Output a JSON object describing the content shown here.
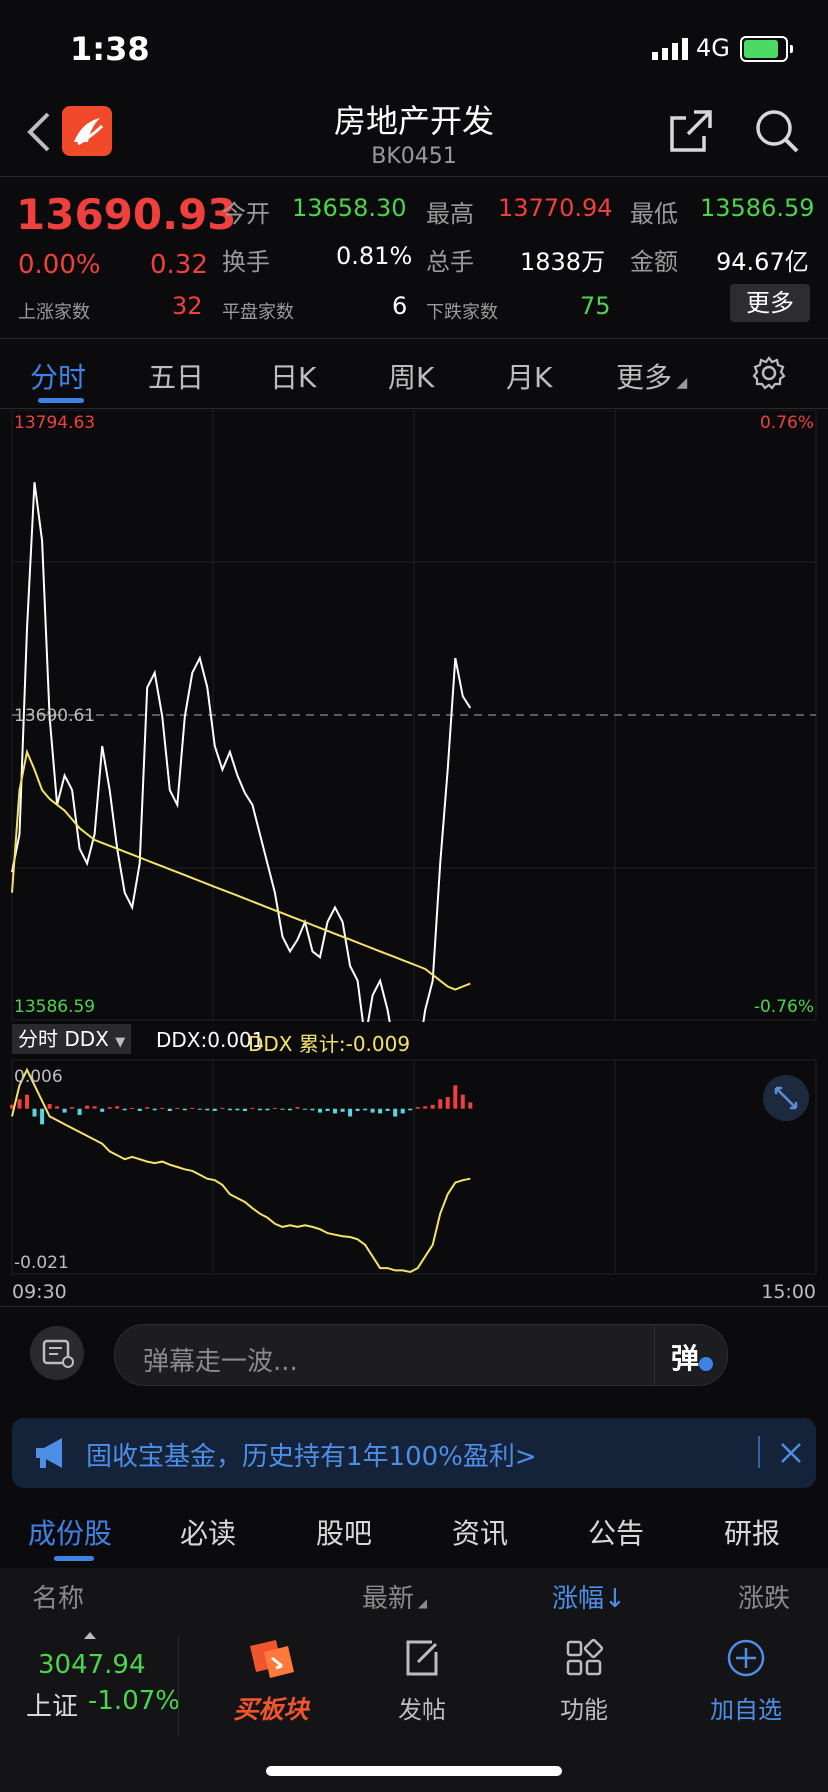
{
  "status_bar": {
    "time": "1:38",
    "network": "4G"
  },
  "nav": {
    "title": "房地产开发",
    "code": "BK0451"
  },
  "quote": {
    "price": "13690.93",
    "change_pct": "0.00%",
    "change": "0.32",
    "open_label": "今开",
    "open": "13658.30",
    "high_label": "最高",
    "high": "13770.94",
    "low_label": "最低",
    "low": "13586.59",
    "turnover_label": "换手",
    "turnover": "0.81%",
    "volume_label": "总手",
    "volume": "1838万",
    "amount_label": "金额",
    "amount": "94.67亿",
    "up_label": "上涨家数",
    "up": "32",
    "flat_label": "平盘家数",
    "flat": "6",
    "down_label": "下跌家数",
    "down": "75",
    "more_button": "更多"
  },
  "chart_tabs": [
    "分时",
    "五日",
    "日K",
    "周K",
    "月K",
    "更多"
  ],
  "chart_data": [
    {
      "type": "line",
      "y_top_label": "13794.63",
      "y_mid_label": "13690.61",
      "y_bottom_label": "13586.59",
      "pct_top_label": "0.76%",
      "pct_bottom_label": "-0.76%",
      "ylim": [
        13586.59,
        13794.63
      ],
      "baseline": 13690.61,
      "grid": true,
      "series": [
        {
          "values": [
            13637,
            13650,
            13720,
            13770,
            13750,
            13690,
            13660,
            13670,
            13665,
            13645,
            13640,
            13650,
            13680,
            13665,
            13645,
            13630,
            13625,
            13640,
            13700,
            13705,
            13690,
            13665,
            13660,
            13690,
            13705,
            13710,
            13700,
            13680,
            13672,
            13678,
            13670,
            13664,
            13660,
            13650,
            13640,
            13630,
            13615,
            13610,
            13614,
            13620,
            13610,
            13608,
            13620,
            13625,
            13620,
            13605,
            13600,
            13580,
            13595,
            13600,
            13590,
            13575,
            13570,
            13578,
            13573,
            13590,
            13600,
            13640,
            13672,
            13710,
            13697,
            13693
          ]
        },
        {
          "values": [
            13630,
            13665,
            13678,
            13672,
            13665,
            13662,
            13660,
            13658,
            13655,
            13652,
            13650,
            13648,
            13647,
            13646,
            13645,
            13644,
            13643,
            13642,
            13641,
            13640,
            13639,
            13638,
            13637,
            13636,
            13635,
            13634,
            13633,
            13632,
            13631,
            13630,
            13629,
            13628,
            13627,
            13626,
            13625,
            13624,
            13623,
            13622,
            13621,
            13620,
            13619,
            13618,
            13617,
            13616,
            13615,
            13614,
            13613,
            13612,
            13611,
            13610,
            13609,
            13608,
            13607,
            13606,
            13605,
            13604,
            13602,
            13600,
            13598,
            13597,
            13598,
            13599
          ]
        }
      ]
    },
    {
      "type": "bar",
      "ylim": [
        -0.021,
        0.006
      ],
      "legend_name": "分时 DDX",
      "ddx_label": "DDX:0.001",
      "ddx_cum_label": "DDX 累计:-0.009",
      "y_top_label": "0.006",
      "y_bottom_label": "-0.021",
      "x_start_label": "09:30",
      "x_end_label": "15:00",
      "series": [
        {
          "values": [
            0.0005,
            0.0012,
            0.0018,
            -0.001,
            -0.002,
            0.0006,
            0.0003,
            -0.0005,
            0.0002,
            -0.0008,
            0.0004,
            0.0003,
            -0.0004,
            0.0002,
            0.0003,
            -0.0002,
            0.0001,
            -0.0003,
            0.0002,
            -0.0002,
            0.0001,
            -0.0003,
            0.0001,
            -0.0002,
            0.0001,
            -0.0001,
            -0.0002,
            -0.0003,
            0.0001,
            -0.0002,
            -0.0002,
            -0.0003,
            0.0001,
            -0.0002,
            -0.0002,
            0.0001,
            -0.0001,
            -0.0002,
            0.0002,
            -0.0001,
            -0.0002,
            -0.0005,
            -0.0003,
            -0.0006,
            -0.0004,
            -0.001,
            -0.0003,
            -0.0002,
            -0.0005,
            -0.0006,
            -0.0003,
            -0.001,
            -0.0006,
            -0.0002,
            0.0002,
            0.0003,
            0.0005,
            0.0012,
            0.0015,
            0.003,
            0.0018,
            0.0008
          ]
        },
        {
          "values": [
            -0.001,
            0.003,
            0.005,
            0.003,
            0.001,
            -0.001,
            -0.0015,
            -0.002,
            -0.0025,
            -0.003,
            -0.0035,
            -0.004,
            -0.0045,
            -0.0055,
            -0.006,
            -0.0065,
            -0.0062,
            -0.0065,
            -0.0068,
            -0.007,
            -0.0068,
            -0.0072,
            -0.0075,
            -0.0078,
            -0.008,
            -0.0085,
            -0.009,
            -0.0092,
            -0.0098,
            -0.011,
            -0.0115,
            -0.012,
            -0.0128,
            -0.0135,
            -0.014,
            -0.0148,
            -0.0152,
            -0.015,
            -0.0152,
            -0.015,
            -0.0152,
            -0.0155,
            -0.016,
            -0.0162,
            -0.0164,
            -0.0165,
            -0.0168,
            -0.0175,
            -0.019,
            -0.0205,
            -0.0205,
            -0.0208,
            -0.0208,
            -0.021,
            -0.0205,
            -0.019,
            -0.0175,
            -0.0135,
            -0.011,
            -0.0095,
            -0.0092,
            -0.009
          ]
        }
      ]
    }
  ],
  "danmu": {
    "placeholder": "弹幕走一波...",
    "button": "弹"
  },
  "ad": {
    "text": "固收宝基金，历史持有1年100%盈利>"
  },
  "lower_tabs": [
    "成份股",
    "必读",
    "股吧",
    "资讯",
    "公告",
    "研报"
  ],
  "table_header": {
    "name": "名称",
    "latest": "最新",
    "change_pct": "涨幅",
    "change": "涨跌"
  },
  "bottom_bar": {
    "index_value": "3047.94",
    "index_name": "上证",
    "index_change": "-1.07%",
    "items": [
      "买板块",
      "发帖",
      "功能",
      "加自选"
    ]
  },
  "colors": {
    "up": "#f0403e",
    "down": "#4cd44c",
    "accent": "#3f82e6",
    "avg_line": "#f4e36a"
  }
}
